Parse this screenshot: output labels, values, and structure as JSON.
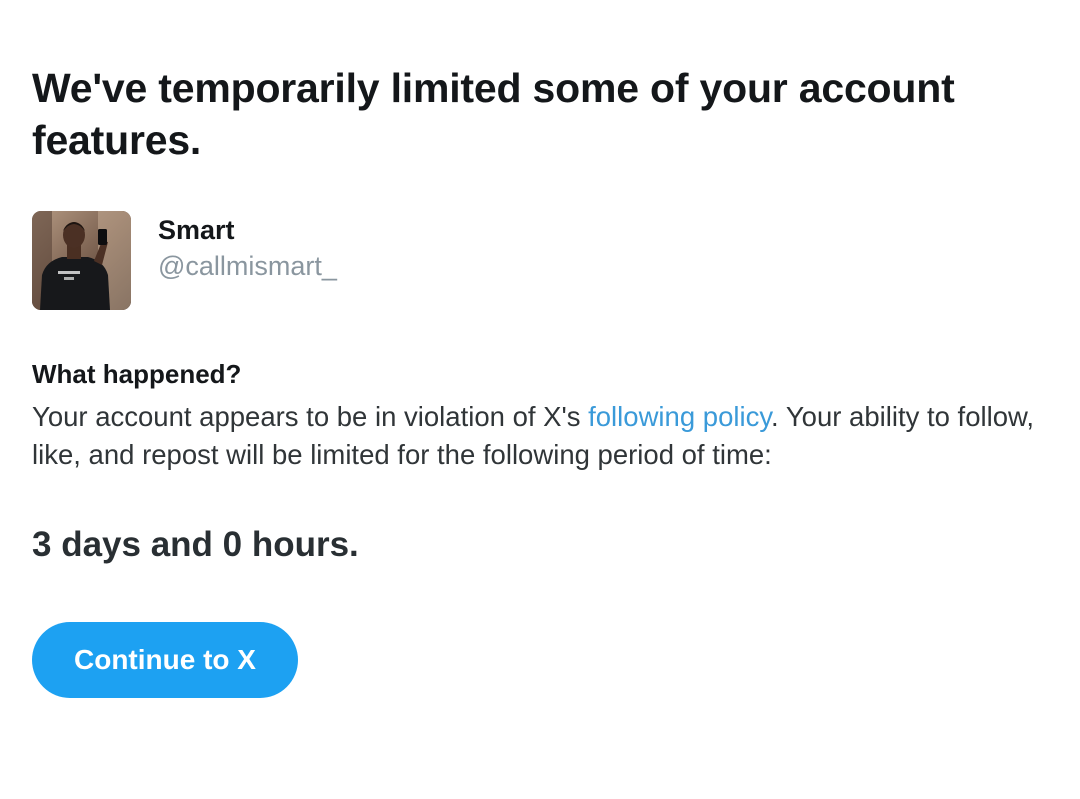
{
  "notice": {
    "headline": "We've temporarily limited some of your account features."
  },
  "profile": {
    "display_name": "Smart",
    "handle": "@callmismart_",
    "avatar_icon": "user-photo-avatar"
  },
  "details": {
    "heading": "What happened?",
    "body_before_link": "Your account appears to be in violation of X's ",
    "link_text": "following policy",
    "body_after_link": ". Your ability to follow, like, and repost will be limited for the following period of time:"
  },
  "restriction": {
    "duration": "3 days and 0 hours."
  },
  "actions": {
    "continue_label": "Continue to X"
  },
  "colors": {
    "accent": "#1da1f2",
    "link": "#3a9ad9",
    "handle_text": "#8a969f",
    "primary_text": "#14171a"
  }
}
